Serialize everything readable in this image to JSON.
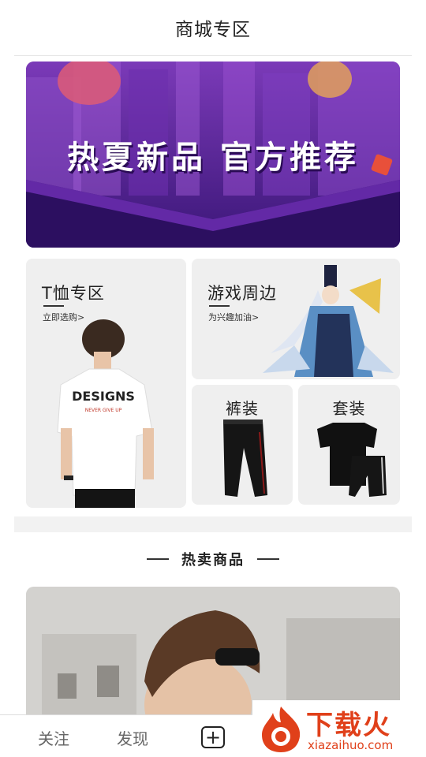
{
  "header": {
    "title": "商城专区"
  },
  "banner": {
    "headline": "热夏新品 官方推荐"
  },
  "categories": {
    "tshirt": {
      "title": "T恤专区",
      "subtitle": "立即选购>",
      "print_main": "DESIGNS",
      "print_sub": "NEVER GIVE UP"
    },
    "games": {
      "title": "游戏周边",
      "subtitle": "为兴趣加油>"
    },
    "pants": {
      "title": "裤装"
    },
    "suit": {
      "title": "套装"
    }
  },
  "hot_section": {
    "title": "热卖商品"
  },
  "bottom_nav": {
    "follow": "关注",
    "discover": "发现",
    "plus": "+"
  },
  "watermark": {
    "brand": "下载火",
    "domain": "xiazaihuo.com"
  },
  "colors": {
    "banner_purple": "#5a24a0",
    "watermark_orange": "#e0401a"
  }
}
